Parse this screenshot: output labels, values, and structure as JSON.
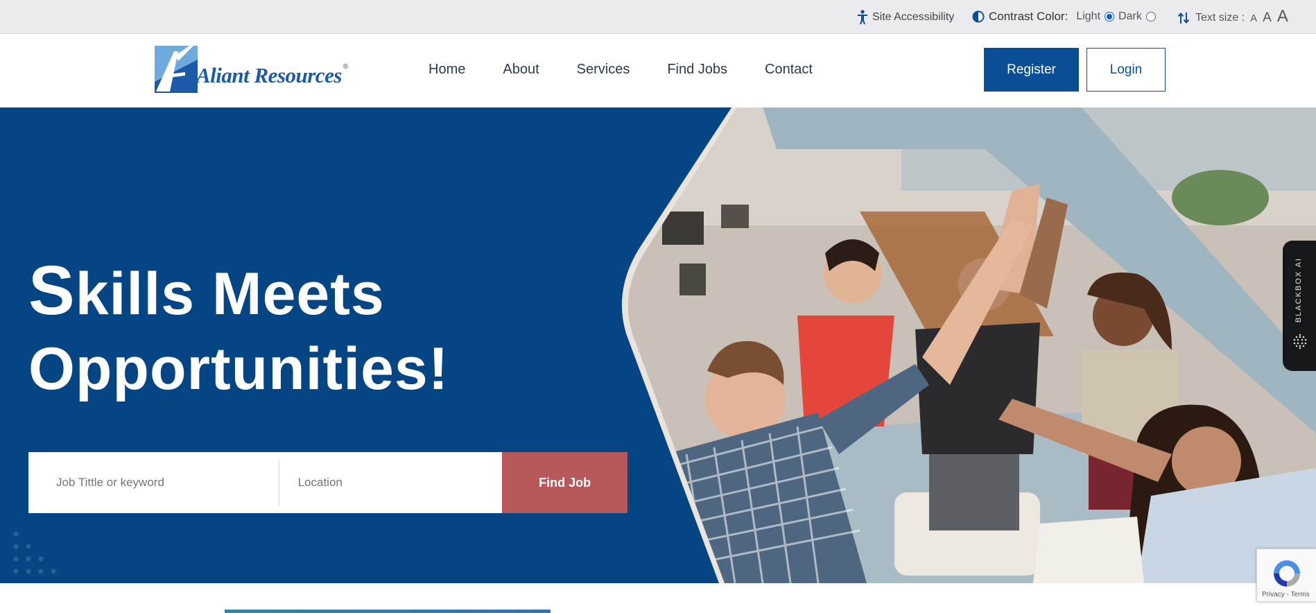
{
  "utility_bar": {
    "accessibility_label": "Site Accessibility",
    "contrast_label": "Contrast Color:",
    "contrast_options": [
      "Light",
      "Dark"
    ],
    "contrast_selected": "Light",
    "text_size_label": "Text size :",
    "text_size_options": [
      "A",
      "A",
      "A"
    ]
  },
  "header": {
    "logo_text": "Aliant Resources",
    "logo_mark": "®",
    "nav": [
      "Home",
      "About",
      "Services",
      "Find Jobs",
      "Contact"
    ],
    "register_label": "Register",
    "login_label": "Login"
  },
  "hero": {
    "title_line1_cap": "S",
    "title_line1_rest": "kills Meets",
    "title_line2": "Opportunities!",
    "search": {
      "keyword_placeholder": "Job Tittle or keyword",
      "location_placeholder": "Location",
      "button_label": "Find Job"
    }
  },
  "widgets": {
    "blackbox_label": "BLACKBOX AI",
    "recaptcha_links": "Privacy - Terms"
  },
  "colors": {
    "hero_bg": "#064583",
    "brand_blue": "#0a4f96",
    "find_button": "#b7585a",
    "utility_bg": "#ececf0"
  },
  "icons": {
    "accessibility": "accessibility-person-icon",
    "contrast": "contrast-half-circle-icon",
    "text_size": "text-size-arrows-icon",
    "recaptcha": "recaptcha-icon"
  }
}
